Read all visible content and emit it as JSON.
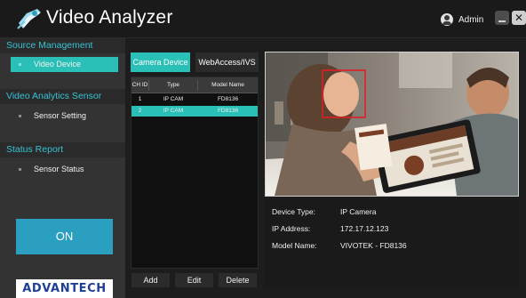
{
  "app": {
    "title": "Video Analyzer",
    "user": "Admin",
    "brand": "ADVANTECH"
  },
  "colors": {
    "accent_teal": "#2ac0b8",
    "section_title": "#36c2d4",
    "on_button": "#2a9fc0",
    "face_box": "#e01e25"
  },
  "icons": {
    "logo": "camera-logo-icon",
    "user": "user-icon",
    "minimize": "minimize-icon",
    "close": "close-icon"
  },
  "sidebar": {
    "sections": [
      {
        "title": "Source Management",
        "items": [
          {
            "label": "Video Device",
            "active": true
          }
        ]
      },
      {
        "title": "Video Analytics Sensor",
        "items": [
          {
            "label": "Sensor Setting",
            "active": false
          }
        ]
      },
      {
        "title": "Status Report",
        "items": [
          {
            "label": "Sensor Status",
            "active": false
          }
        ]
      }
    ],
    "power_button": "ON"
  },
  "tabs": [
    {
      "label": "Camera Device",
      "active": true
    },
    {
      "label": "WebAccess/IVS",
      "active": false
    }
  ],
  "device_table": {
    "columns": [
      "CH ID",
      "Type",
      "Model Name"
    ],
    "rows": [
      {
        "ch_id": "1",
        "type": "IP CAM",
        "model": "FD8136",
        "selected": false
      },
      {
        "ch_id": "2",
        "type": "IP CAM",
        "model": "FD8136",
        "selected": true
      }
    ],
    "buttons": {
      "add": "Add",
      "edit": "Edit",
      "delete": "Delete"
    }
  },
  "device_info": {
    "device_type_label": "Device Type:",
    "device_type": "IP Camera",
    "ip_label": "IP Address:",
    "ip": "172.17.12.123",
    "model_label": "Model Name:",
    "model": "VIVOTEK - FD8136"
  }
}
